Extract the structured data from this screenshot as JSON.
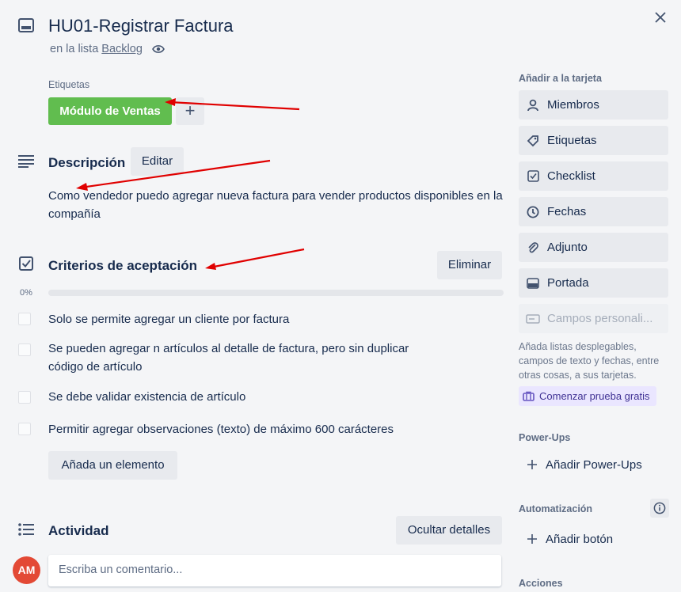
{
  "card": {
    "title": "HU01-Registrar Factura",
    "list_prefix": "en la lista ",
    "list_name": "Backlog"
  },
  "labels": {
    "heading": "Etiquetas",
    "items": [
      {
        "text": "Módulo de Ventas",
        "color": "#61bd4f"
      }
    ],
    "add": "+"
  },
  "description": {
    "heading": "Descripción",
    "edit_label": "Editar",
    "text": "Como vendedor puedo agregar nueva factura para vender productos disponibles en la compañía"
  },
  "checklist": {
    "heading": "Criterios de aceptación",
    "delete_label": "Eliminar",
    "progress_label": "0%",
    "progress_fraction": 0,
    "items": [
      "Solo se permite agregar un cliente por factura",
      "Se pueden agregar n artículos al detalle de factura, pero sin duplicar código de artículo",
      "Se debe validar existencia de artículo",
      "Permitir agregar observaciones (texto) de máximo 600 carácteres"
    ],
    "add_item_label": "Añada un elemento"
  },
  "activity": {
    "heading": "Actividad",
    "hide_details_label": "Ocultar detalles",
    "avatar_initials": "AM",
    "avatar_color": "#e34935",
    "comment_placeholder": "Escriba un comentario..."
  },
  "sidebar": {
    "add_to_card_title": "Añadir a la tarjeta",
    "buttons": [
      {
        "label": "Miembros",
        "icon": "person-icon"
      },
      {
        "label": "Etiquetas",
        "icon": "tag-icon"
      },
      {
        "label": "Checklist",
        "icon": "checkbox-icon"
      },
      {
        "label": "Fechas",
        "icon": "clock-icon"
      },
      {
        "label": "Adjunto",
        "icon": "paperclip-icon"
      },
      {
        "label": "Portada",
        "icon": "cover-icon"
      }
    ],
    "custom_fields_label": "Campos personali...",
    "custom_fields_note": "Añada listas desplegables, campos de texto y fechas, entre otras cosas, a sus tarjetas.",
    "trial_label": "Comenzar prueba gratis",
    "powerups_title": "Power-Ups",
    "add_powerups_label": "Añadir Power-Ups",
    "automation_title": "Automatización",
    "add_button_label": "Añadir botón",
    "actions_title": "Acciones"
  },
  "colors": {
    "accent_green": "#61bd4f",
    "annotation_red": "#e00000"
  }
}
